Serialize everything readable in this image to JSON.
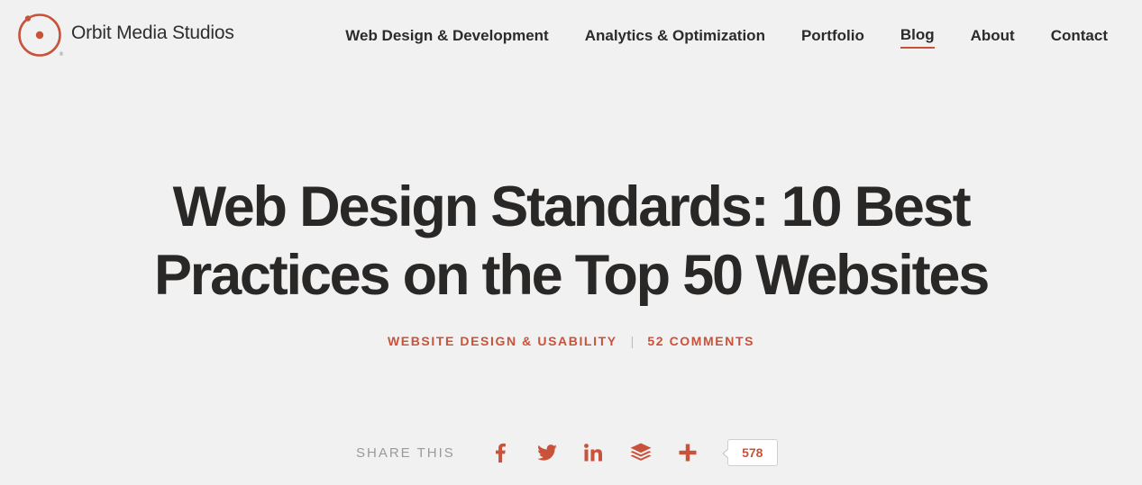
{
  "brand": {
    "name": "Orbit Media Studios",
    "registered_mark": "®",
    "accent_color": "#c9523a",
    "logo_icon": "orbit-logo-icon"
  },
  "nav": {
    "items": [
      {
        "label": "Web Design & Development",
        "active": false
      },
      {
        "label": "Analytics & Optimization",
        "active": false
      },
      {
        "label": "Portfolio",
        "active": false
      },
      {
        "label": "Blog",
        "active": true
      },
      {
        "label": "About",
        "active": false
      },
      {
        "label": "Contact",
        "active": false
      }
    ]
  },
  "article": {
    "title_line1": "Web Design Standards: 10 Best",
    "title_line2": "Practices on the Top 50 Websites",
    "category": "WEBSITE DESIGN & USABILITY",
    "separator": "|",
    "comments": "52 COMMENTS"
  },
  "share": {
    "label": "SHARE THIS",
    "buttons": [
      {
        "icon": "facebook-icon"
      },
      {
        "icon": "twitter-icon"
      },
      {
        "icon": "linkedin-icon"
      },
      {
        "icon": "buffer-icon"
      },
      {
        "icon": "plus-icon"
      }
    ],
    "count": "578"
  }
}
